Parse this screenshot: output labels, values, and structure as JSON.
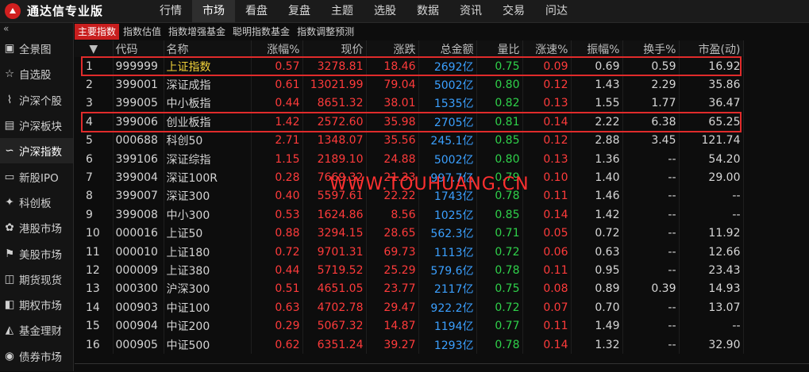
{
  "app": {
    "title": "通达信专业版"
  },
  "menu": [
    "行情",
    "市场",
    "看盘",
    "复盘",
    "主题",
    "选股",
    "数据",
    "资讯",
    "交易",
    "问达"
  ],
  "menu_active": 1,
  "sidebar": {
    "collapse_symbol": "«",
    "items": [
      {
        "label": "全景图",
        "icon": "panorama-icon"
      },
      {
        "label": "自选股",
        "icon": "star-icon"
      },
      {
        "label": "沪深个股",
        "icon": "stock-chart-icon"
      },
      {
        "label": "沪深板块",
        "icon": "sector-icon"
      },
      {
        "label": "沪深指数",
        "icon": "index-icon"
      },
      {
        "label": "新股IPO",
        "icon": "ipo-icon"
      },
      {
        "label": "科创板",
        "icon": "star-market-icon"
      },
      {
        "label": "港股市场",
        "icon": "hk-icon"
      },
      {
        "label": "美股市场",
        "icon": "us-icon"
      },
      {
        "label": "期货现货",
        "icon": "futures-icon"
      },
      {
        "label": "期权市场",
        "icon": "options-icon"
      },
      {
        "label": "基金理财",
        "icon": "fund-icon"
      },
      {
        "label": "债券市场",
        "icon": "bond-icon"
      }
    ],
    "active_index": 4
  },
  "tabs": [
    "主要指数",
    "指数估值",
    "指数增强基金",
    "聪明指数基金",
    "指数调整预测"
  ],
  "table": {
    "headers": [
      "",
      "代码",
      "名称",
      "涨幅%",
      "现价",
      "涨跌",
      "总金额",
      "量比",
      "涨速%",
      "振幅%",
      "换手%",
      "市盈(动)"
    ],
    "sort_indicator": "▼",
    "rows": [
      [
        "1",
        "999999",
        "上证指数",
        "0.57",
        "3278.81",
        "18.46",
        "2692亿",
        "0.75",
        "0.09",
        "0.69",
        "0.59",
        "16.92"
      ],
      [
        "2",
        "399001",
        "深证成指",
        "0.61",
        "13021.99",
        "79.04",
        "5002亿",
        "0.80",
        "0.12",
        "1.43",
        "2.29",
        "35.86"
      ],
      [
        "3",
        "399005",
        "中小板指",
        "0.44",
        "8651.32",
        "38.01",
        "1535亿",
        "0.82",
        "0.13",
        "1.55",
        "1.77",
        "36.47"
      ],
      [
        "4",
        "399006",
        "创业板指",
        "1.42",
        "2572.60",
        "35.98",
        "2705亿",
        "0.81",
        "0.14",
        "2.22",
        "6.38",
        "65.25"
      ],
      [
        "5",
        "000688",
        "科创50",
        "2.71",
        "1348.07",
        "35.56",
        "245.1亿",
        "0.85",
        "0.12",
        "2.88",
        "3.45",
        "121.74"
      ],
      [
        "6",
        "399106",
        "深证综指",
        "1.15",
        "2189.10",
        "24.88",
        "5002亿",
        "0.80",
        "0.13",
        "1.36",
        "--",
        "54.20"
      ],
      [
        "7",
        "399004",
        "深证100R",
        "0.28",
        "7669.32",
        "21.33",
        "997.7亿",
        "0.79",
        "0.10",
        "1.40",
        "--",
        "29.00"
      ],
      [
        "8",
        "399007",
        "深证300",
        "0.40",
        "5597.61",
        "22.22",
        "1743亿",
        "0.78",
        "0.11",
        "1.46",
        "--",
        "--"
      ],
      [
        "9",
        "399008",
        "中小300",
        "0.53",
        "1624.86",
        "8.56",
        "1025亿",
        "0.85",
        "0.14",
        "1.42",
        "--",
        "--"
      ],
      [
        "10",
        "000016",
        "上证50",
        "0.88",
        "3294.15",
        "28.65",
        "562.3亿",
        "0.71",
        "0.05",
        "0.72",
        "--",
        "11.92"
      ],
      [
        "11",
        "000010",
        "上证180",
        "0.72",
        "9701.31",
        "69.73",
        "1113亿",
        "0.72",
        "0.06",
        "0.63",
        "--",
        "12.66"
      ],
      [
        "12",
        "000009",
        "上证380",
        "0.44",
        "5719.52",
        "25.29",
        "579.6亿",
        "0.78",
        "0.11",
        "0.95",
        "--",
        "23.43"
      ],
      [
        "13",
        "000300",
        "沪深300",
        "0.51",
        "4651.05",
        "23.77",
        "2117亿",
        "0.75",
        "0.08",
        "0.89",
        "0.39",
        "14.93"
      ],
      [
        "14",
        "000903",
        "中证100",
        "0.63",
        "4702.78",
        "29.47",
        "922.2亿",
        "0.72",
        "0.07",
        "0.70",
        "--",
        "13.07"
      ],
      [
        "15",
        "000904",
        "中证200",
        "0.29",
        "5067.32",
        "14.87",
        "1194亿",
        "0.77",
        "0.11",
        "1.49",
        "--",
        "--"
      ],
      [
        "16",
        "000905",
        "中证500",
        "0.62",
        "6351.24",
        "39.27",
        "1293亿",
        "0.78",
        "0.14",
        "1.32",
        "--",
        "32.90"
      ]
    ],
    "highlighted_rows": [
      0,
      3
    ],
    "selected_row": 0
  },
  "watermark": "WWW.TOUHUANG.CN",
  "colors": {
    "up": "#ff3b3b",
    "volume_ratio": "#2fd14a",
    "amount": "#3ba0ff",
    "highlight_border": "#e02b2b",
    "tab_active": "#c81e1e"
  }
}
